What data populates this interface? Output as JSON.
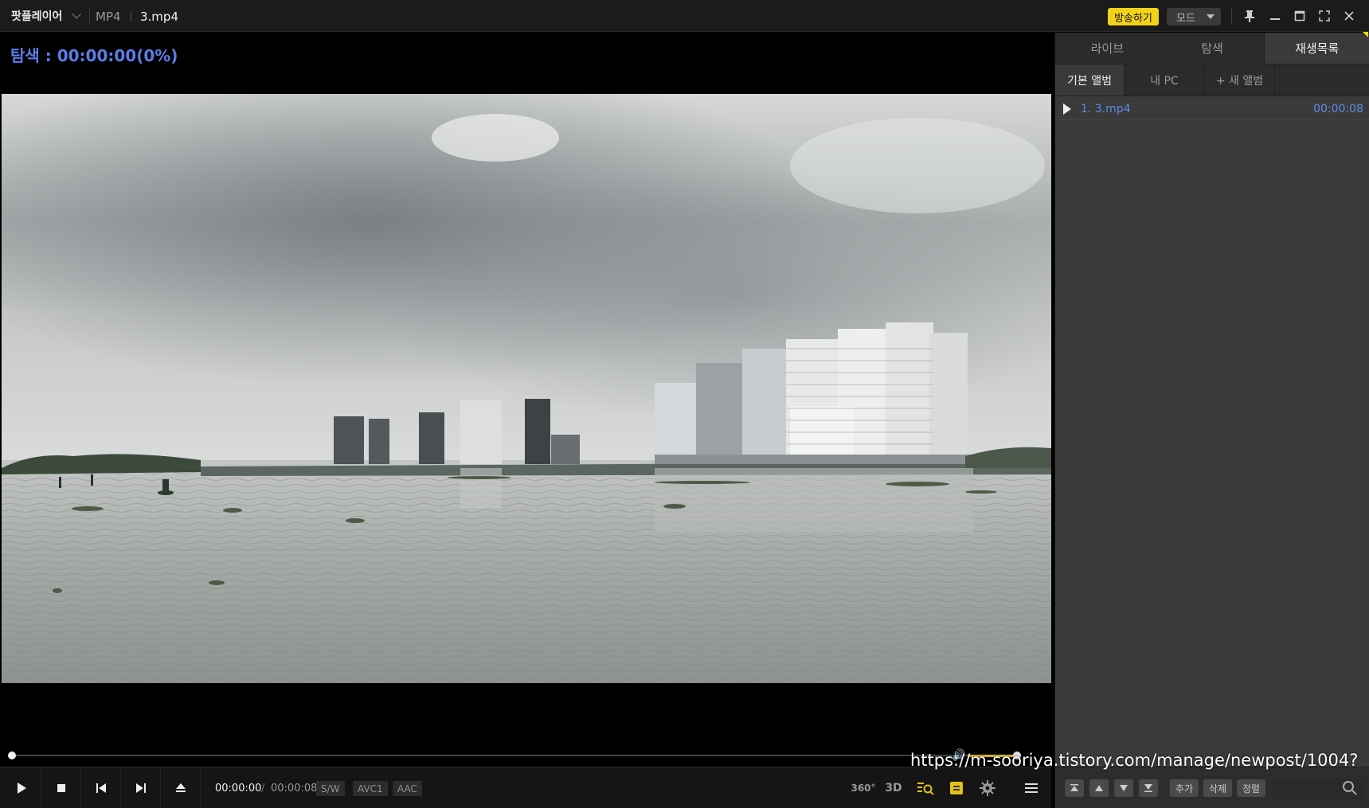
{
  "titlebar": {
    "app_name": "팟플레이어",
    "file_format": "MP4",
    "file_name": "3.mp4",
    "broadcast_label": "방송하기",
    "mode_label": "모드"
  },
  "overlay": {
    "search_status": "탐색 : 00:00:00(0%)"
  },
  "controls": {
    "current_time": "00:00:00",
    "separator": "/",
    "total_time": "00:00:08",
    "tags": [
      "S/W",
      "AVC1",
      "AAC"
    ],
    "icon_360": "360°",
    "icon_3d": "3D"
  },
  "sidebar": {
    "tabs": [
      {
        "label": "라이브",
        "active": false
      },
      {
        "label": "탐색",
        "active": false
      },
      {
        "label": "재생목록",
        "active": true
      }
    ],
    "album_tabs": [
      {
        "label": "기본 앨범",
        "active": true
      },
      {
        "label": "내 PC",
        "active": false
      },
      {
        "label": "+ 새 앨범",
        "active": false
      }
    ],
    "playlist": [
      {
        "name": "1. 3.mp4",
        "duration": "00:00:08"
      }
    ],
    "bottom_buttons": [
      "추가",
      "삭제",
      "정렬"
    ],
    "search_placeholder": ""
  },
  "watermark": "https://m-sooriya.tistory.com/manage/newpost/1004?",
  "colors": {
    "accent_yellow": "#f3d21a",
    "accent_blue": "#5b7de8",
    "playlist_blue": "#5b8fe6"
  }
}
